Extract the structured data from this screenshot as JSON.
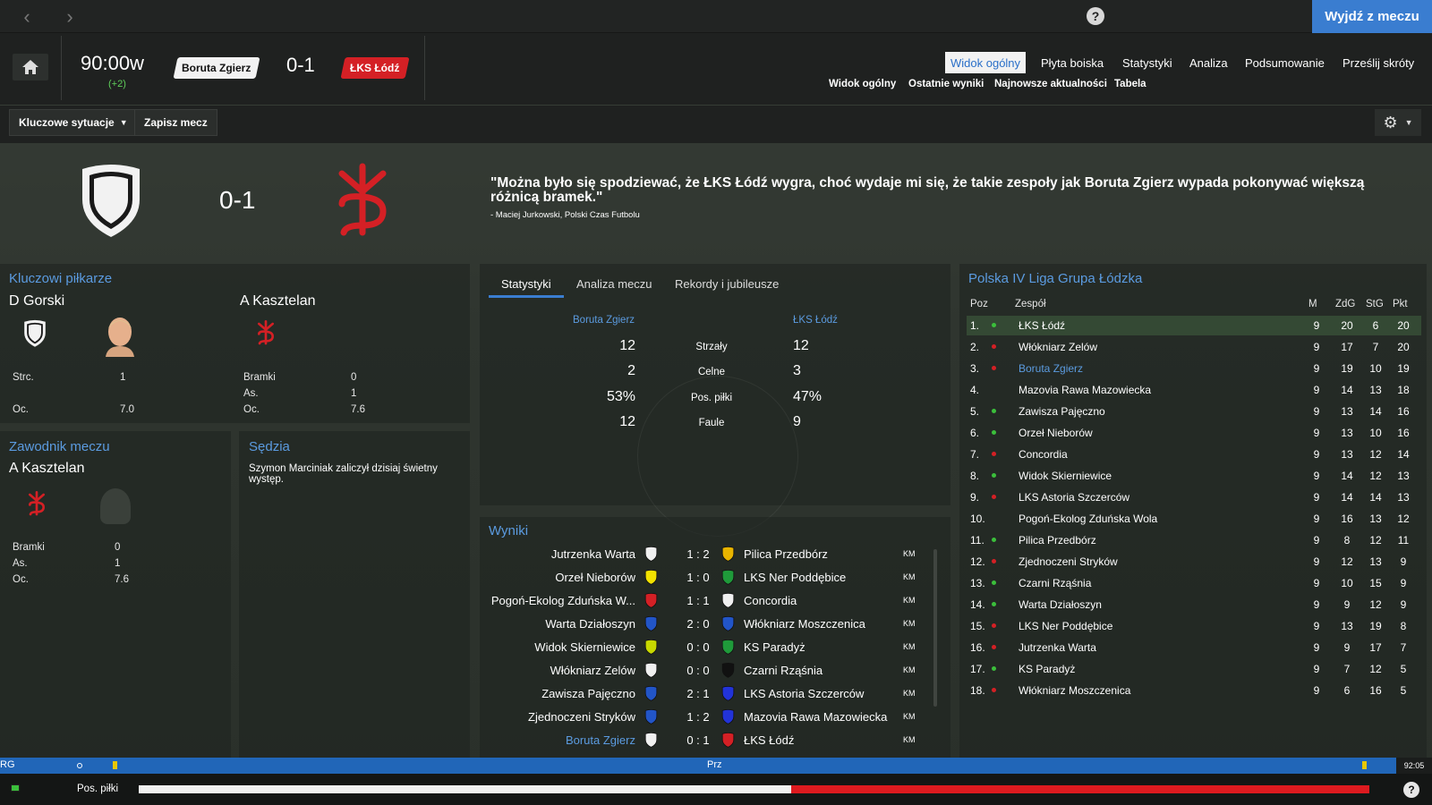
{
  "topbar": {
    "exit_label": "Wyjdź z meczu",
    "help": "?"
  },
  "header": {
    "clock": "90:00w",
    "added": "(+2)",
    "home_team": "Boruta Zgierz",
    "score": "0-1",
    "away_team": "ŁKS Łódź",
    "tabs": [
      {
        "label": "Widok ogólny",
        "active": true
      },
      {
        "label": "Płyta boiska"
      },
      {
        "label": "Statystyki"
      },
      {
        "label": "Analiza"
      },
      {
        "label": "Podsumowanie"
      },
      {
        "label": "Prześlij skróty"
      }
    ],
    "subtabs": [
      "Widok ogólny",
      "Ostatnie wyniki",
      "Najnowsze aktualności",
      "Tabela"
    ]
  },
  "toolbar": {
    "key_moments": "Kluczowe sytuacje",
    "save_match": "Zapisz mecz"
  },
  "banner": {
    "score": "0-1",
    "quote": "\"Można było się spodziewać, że ŁKS Łódź wygra, choć wydaje mi się, że takie zespoły jak Boruta Zgierz wypada pokonywać większą różnicą bramek.\"",
    "attribution": "- Maciej Jurkowski, Polski Czas Futbolu"
  },
  "key_players": {
    "title": "Kluczowi piłkarze",
    "home": {
      "name": "D Gorski",
      "stats": [
        {
          "label": "Strc.",
          "value": "1"
        },
        {
          "label": "Oc.",
          "value": "7.0"
        }
      ]
    },
    "away": {
      "name": "A Kasztelan",
      "stats": [
        {
          "label": "Bramki",
          "value": "0"
        },
        {
          "label": "As.",
          "value": "1"
        },
        {
          "label": "Oc.",
          "value": "7.6"
        }
      ]
    }
  },
  "motm": {
    "title": "Zawodnik meczu",
    "name": "A Kasztelan",
    "stats": [
      {
        "label": "Bramki",
        "value": "0"
      },
      {
        "label": "As.",
        "value": "1"
      },
      {
        "label": "Oc.",
        "value": "7.6"
      }
    ]
  },
  "referee": {
    "title": "Sędzia",
    "text": "Szymon Marciniak zaliczył dzisiaj świetny występ."
  },
  "stats": {
    "tabs": [
      "Statystyki",
      "Analiza meczu",
      "Rekordy i jubileusze"
    ],
    "home": "Boruta Zgierz",
    "away": "ŁKS Łódź",
    "rows": [
      {
        "label": "Strzały",
        "home": "12",
        "away": "12"
      },
      {
        "label": "Celne",
        "home": "2",
        "away": "3"
      },
      {
        "label": "Pos. piłki",
        "home": "53%",
        "away": "47%"
      },
      {
        "label": "Faule",
        "home": "12",
        "away": "9"
      }
    ]
  },
  "results": {
    "title": "Wyniki",
    "rows": [
      {
        "home": "Jutrzenka Warta",
        "score": "1 : 2",
        "away": "Pilica Przedbórz",
        "tag": "KM",
        "hc": "#f0f0f0",
        "ac": "#e8b400"
      },
      {
        "home": "Orzeł Nieborów",
        "score": "1 : 0",
        "away": "LKS Ner Poddębice",
        "tag": "KM",
        "hc": "#f2e200",
        "ac": "#1f9a3a"
      },
      {
        "home": "Pogoń-Ekolog Zduńska W...",
        "score": "1 : 1",
        "away": "Concordia",
        "tag": "KM",
        "hc": "#d42025",
        "ac": "#f0f0f0"
      },
      {
        "home": "Warta Działoszyn",
        "score": "2 : 0",
        "away": "Włókniarz Moszczenica",
        "tag": "KM",
        "hc": "#2255c8",
        "ac": "#2255c8"
      },
      {
        "home": "Widok Skierniewice",
        "score": "0 : 0",
        "away": "KS Paradyż",
        "tag": "KM",
        "hc": "#c8d800",
        "ac": "#1f9a3a"
      },
      {
        "home": "Włókniarz Zelów",
        "score": "0 : 0",
        "away": "Czarni Rząśnia",
        "tag": "KM",
        "hc": "#f0f0f0",
        "ac": "#111111"
      },
      {
        "home": "Zawisza Pajęczno",
        "score": "2 : 1",
        "away": "LKS Astoria Szczerców",
        "tag": "KM",
        "hc": "#2255c8",
        "ac": "#2233d8"
      },
      {
        "home": "Zjednoczeni Stryków",
        "score": "1 : 2",
        "away": "Mazovia Rawa Mazowiecka",
        "tag": "KM",
        "hc": "#2255c8",
        "ac": "#2233d8"
      },
      {
        "home": "Boruta Zgierz",
        "score": "0 : 1",
        "away": "ŁKS Łódź",
        "tag": "KM",
        "hc": "#f0f0f0",
        "ac": "#d42025",
        "home_hl": true
      }
    ]
  },
  "league": {
    "title": "Polska IV Liga Grupa Łódzka",
    "headers": [
      "Poz",
      "Zespół",
      "M",
      "ZdG",
      "StG",
      "Pkt"
    ],
    "rows": [
      {
        "pos": "1.",
        "arrow": "up",
        "team": "ŁKS Łódź",
        "m": "9",
        "zdg": "20",
        "stg": "6",
        "pkt": "20",
        "hl": true
      },
      {
        "pos": "2.",
        "arrow": "down",
        "team": "Włókniarz Zelów",
        "m": "9",
        "zdg": "17",
        "stg": "7",
        "pkt": "20"
      },
      {
        "pos": "3.",
        "arrow": "down",
        "team": "Boruta Zgierz",
        "m": "9",
        "zdg": "19",
        "stg": "10",
        "pkt": "19",
        "blue": true
      },
      {
        "pos": "4.",
        "arrow": "",
        "team": "Mazovia Rawa Mazowiecka",
        "m": "9",
        "zdg": "14",
        "stg": "13",
        "pkt": "18"
      },
      {
        "pos": "5.",
        "arrow": "up",
        "team": "Zawisza Pajęczno",
        "m": "9",
        "zdg": "13",
        "stg": "14",
        "pkt": "16"
      },
      {
        "pos": "6.",
        "arrow": "up",
        "team": "Orzeł Nieborów",
        "m": "9",
        "zdg": "13",
        "stg": "10",
        "pkt": "16"
      },
      {
        "pos": "7.",
        "arrow": "down",
        "team": "Concordia",
        "m": "9",
        "zdg": "13",
        "stg": "12",
        "pkt": "14"
      },
      {
        "pos": "8.",
        "arrow": "up",
        "team": "Widok Skierniewice",
        "m": "9",
        "zdg": "14",
        "stg": "12",
        "pkt": "13"
      },
      {
        "pos": "9.",
        "arrow": "down",
        "team": "LKS Astoria Szczerców",
        "m": "9",
        "zdg": "14",
        "stg": "14",
        "pkt": "13"
      },
      {
        "pos": "10.",
        "arrow": "",
        "team": "Pogoń-Ekolog Zduńska Wola",
        "m": "9",
        "zdg": "16",
        "stg": "13",
        "pkt": "12"
      },
      {
        "pos": "11.",
        "arrow": "up",
        "team": "Pilica Przedbórz",
        "m": "9",
        "zdg": "8",
        "stg": "12",
        "pkt": "11"
      },
      {
        "pos": "12.",
        "arrow": "down",
        "team": "Zjednoczeni Stryków",
        "m": "9",
        "zdg": "12",
        "stg": "13",
        "pkt": "9"
      },
      {
        "pos": "13.",
        "arrow": "up",
        "team": "Czarni Rząśnia",
        "m": "9",
        "zdg": "10",
        "stg": "15",
        "pkt": "9"
      },
      {
        "pos": "14.",
        "arrow": "up",
        "team": "Warta Działoszyn",
        "m": "9",
        "zdg": "9",
        "stg": "12",
        "pkt": "9"
      },
      {
        "pos": "15.",
        "arrow": "down",
        "team": "LKS Ner Poddębice",
        "m": "9",
        "zdg": "13",
        "stg": "19",
        "pkt": "8"
      },
      {
        "pos": "16.",
        "arrow": "down",
        "team": "Jutrzenka Warta",
        "m": "9",
        "zdg": "9",
        "stg": "17",
        "pkt": "7"
      },
      {
        "pos": "17.",
        "arrow": "up",
        "team": "KS Paradyż",
        "m": "9",
        "zdg": "7",
        "stg": "12",
        "pkt": "5"
      },
      {
        "pos": "18.",
        "arrow": "down",
        "team": "Włókniarz Moszczenica",
        "m": "9",
        "zdg": "6",
        "stg": "16",
        "pkt": "5"
      }
    ]
  },
  "timeline": {
    "left": "RG",
    "mid": "Prz",
    "time": "92:05"
  },
  "possession": {
    "label": "Pos. piłki",
    "home_share": 0.53
  },
  "colors": {
    "accent": "#3a7dd0",
    "away": "#d42025",
    "up": "#3bbf3b",
    "down": "#d42025",
    "link": "#5b9be0"
  }
}
